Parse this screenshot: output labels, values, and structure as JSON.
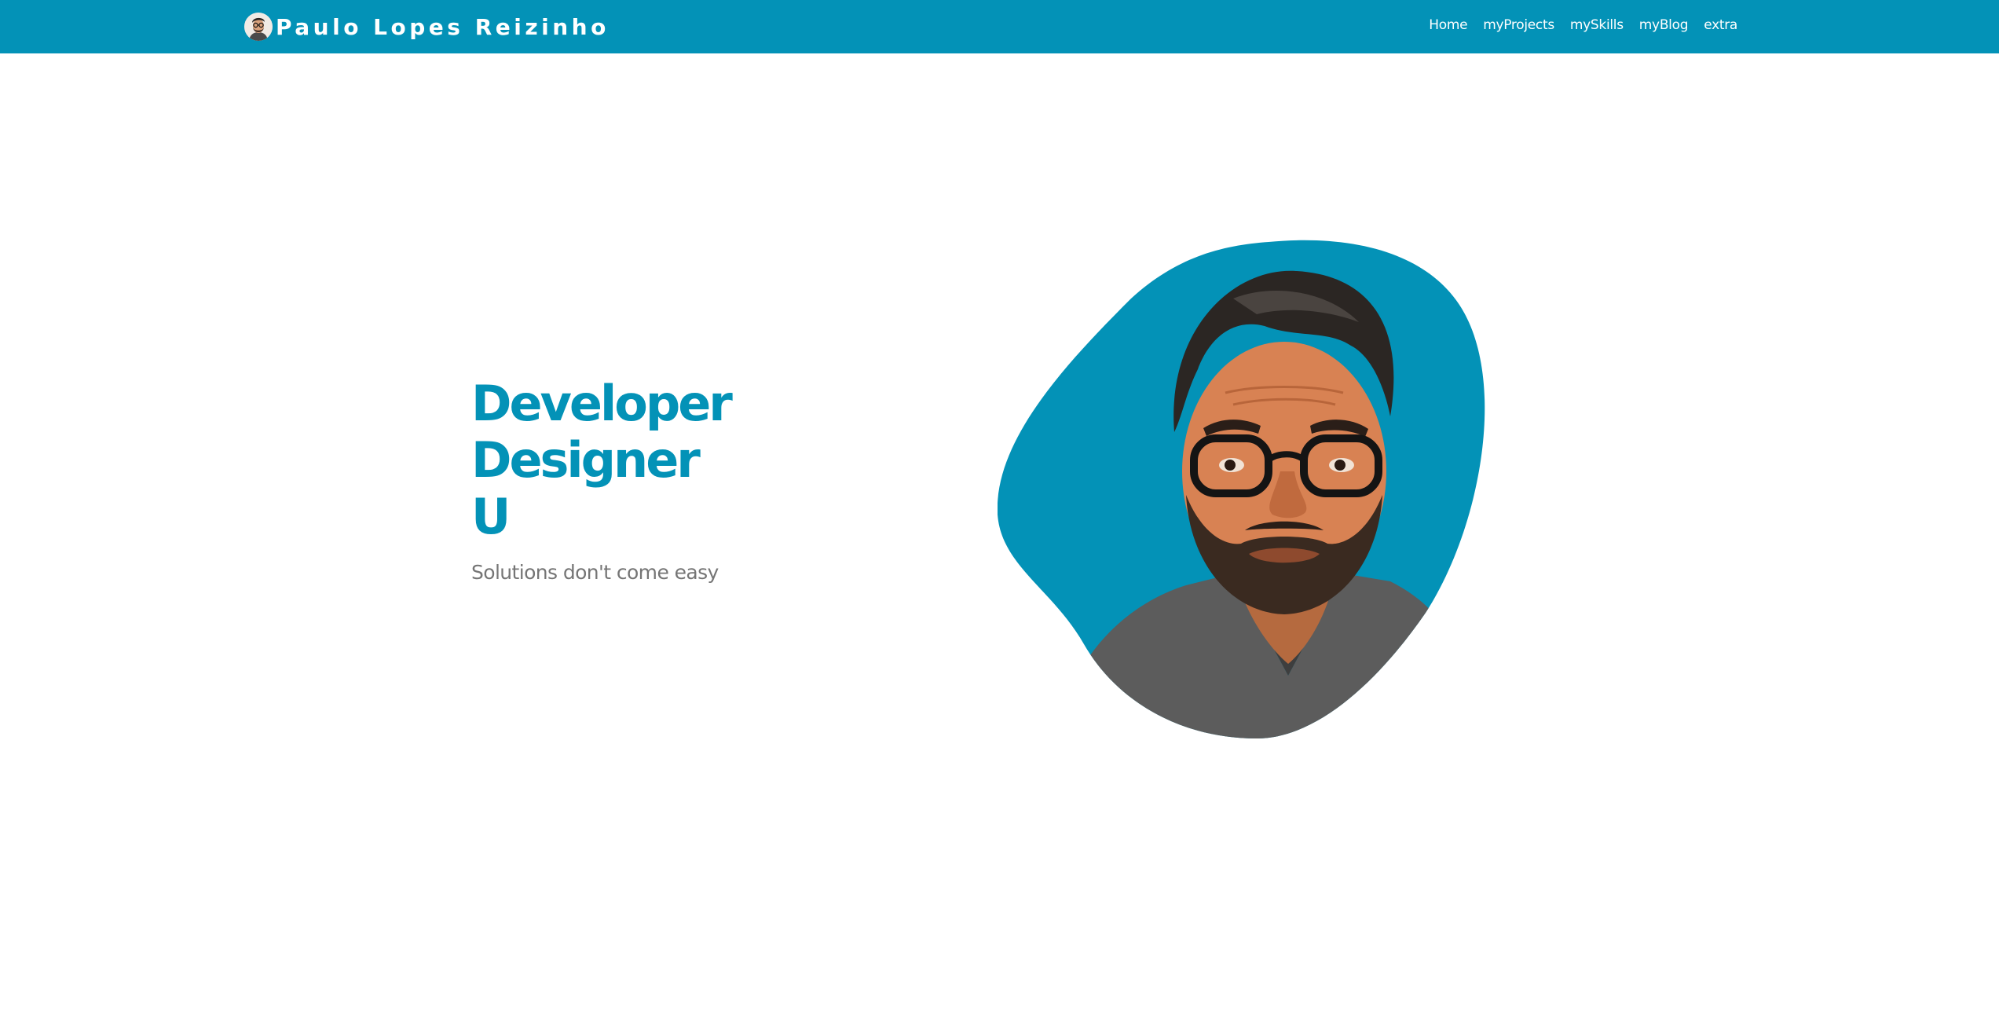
{
  "header": {
    "brand_name": "Paulo Lopes Reizinho",
    "nav": [
      {
        "label": "Home"
      },
      {
        "label": "myProjects"
      },
      {
        "label": "mySkills"
      },
      {
        "label": "myBlog"
      },
      {
        "label": "extra"
      }
    ]
  },
  "hero": {
    "headline": [
      "Developer",
      "Designer",
      "U"
    ],
    "tagline": "Solutions don't come easy"
  },
  "colors": {
    "brand_blue": "#0392b7",
    "tagline_gray": "#757575",
    "background": "#ffffff"
  }
}
